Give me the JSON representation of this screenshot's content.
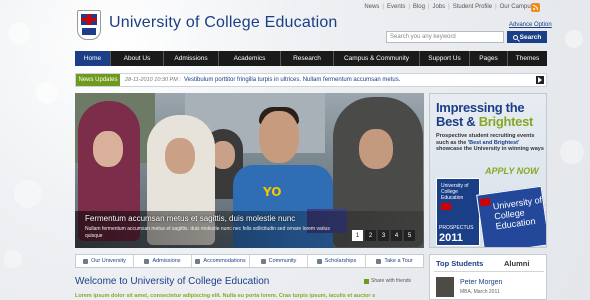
{
  "header": {
    "site_title": "University of College Education",
    "top_links": [
      "News",
      "Events",
      "Blog",
      "Jobs",
      "Student Profile",
      "Our Campuses"
    ],
    "advance_option": "Advance Option",
    "search_placeholder": "Search you any keyword",
    "search_button": "Search",
    "rss_icon": "rss-icon",
    "logo_icon": "university-crest-icon"
  },
  "nav": {
    "items": [
      "Home",
      "About Us",
      "Admissions",
      "Academics",
      "Research",
      "Campus & Community",
      "Support Us",
      "Pages",
      "Themes"
    ],
    "active_index": 0
  },
  "news": {
    "label": "News Updates",
    "date": "28-11-2010 10:30 PM :",
    "text": "Vestibulum porttitor fringilla turpis in ultrices. Nullam fermentum accumsan metus."
  },
  "hero": {
    "title": "Fermentum accumsan metus et sagittis, duis molestie nunc",
    "description": "Nullam fermentum accumsan metus et sagittis. duis molestie nunc nec felis sollicitudin sed ornare lorem varius quisque",
    "shirt_text": "YO",
    "pages": [
      "1",
      "2",
      "3",
      "4",
      "5"
    ],
    "active_page": 0
  },
  "promo": {
    "line1": "Impressing the",
    "line2_a": "Best & ",
    "line2_b": "Brightest",
    "text_a": "Prospective student recruiting events such as the ",
    "text_b": "'Best and Brightest'",
    "text_c": " showcase the University in winning ways",
    "apply": "APPLY NOW",
    "book_title": "University of College Education",
    "book_label": "PROSPECTUS",
    "book_year": "2011",
    "book2_title": "University of College Education"
  },
  "tabs": [
    {
      "label": "Our University",
      "icon": "university-icon"
    },
    {
      "label": "Admissions",
      "icon": "admissions-icon"
    },
    {
      "label": "Accommodations",
      "icon": "home-icon"
    },
    {
      "label": "Community",
      "icon": "people-icon"
    },
    {
      "label": "Scholarships",
      "icon": "scholarship-icon"
    },
    {
      "label": "Take a Tour",
      "icon": "tour-icon"
    }
  ],
  "welcome": {
    "title": "Welcome to University of College Education",
    "share": "Share with friends",
    "lorem": "Lorem ipsum dolor sit amet, consectetur adipiscing elit. Nulla eu porta lorem. Cras turpis ipsum, iaculis et auctor sed,"
  },
  "students": {
    "tab_top": "Top Students",
    "tab_alumni": "Alumni",
    "name": "Peter Morgen",
    "meta": "MBA, March 2011"
  },
  "colors": {
    "brand_blue": "#1b3f86",
    "accent_green": "#86a925",
    "nav_bg": "#1a1a1a"
  }
}
